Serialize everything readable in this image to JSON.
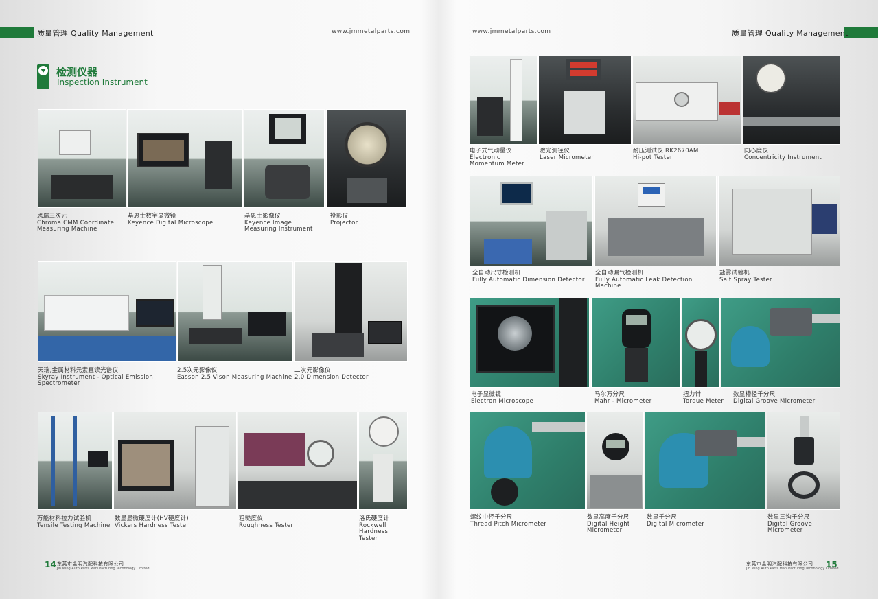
{
  "left_page": {
    "header": {
      "title": "质量管理  Quality Management",
      "url": "www.jmmetalparts.com"
    },
    "section": {
      "title_cn": "检测仪器",
      "title_en": "Inspection Instrument"
    },
    "items": [
      {
        "cn": "思瑞三次元",
        "en": "Chroma CMM Coordinate Measuring Machine"
      },
      {
        "cn": "基恩士数字显微镜",
        "en": "Keyence Digital Microscope"
      },
      {
        "cn": "基恩士影像仪",
        "en": "Keyence Image Measuring Instrument"
      },
      {
        "cn": "投影仪",
        "en": "Projector"
      },
      {
        "cn": "天瑞,金属材料元素直读光谱仪",
        "en": "Skyray Instrument - Optical Emission Spectrometer"
      },
      {
        "cn": "2.5次元影像仪",
        "en": "Easson 2.5 Vison Measuring Machine"
      },
      {
        "cn": "二次元影像仪",
        "en": "2.0 Dimension Detector"
      },
      {
        "cn": "万能材料拉力试验机",
        "en": "Tensile Testing Machine"
      },
      {
        "cn": "数显显微硬度计(HV硬度计)",
        "en": "Vickers Hardness Tester"
      },
      {
        "cn": "粗糙度仪",
        "en": "Roughness Tester"
      },
      {
        "cn": "洛氏硬度计",
        "en": "Rockwell Hardness Tester"
      }
    ],
    "footer": {
      "page_number": "14",
      "company_cn": "东莞市金明汽配科技有限公司",
      "company_en": "Jin Ming Auto Parts Manufacturing Technology Limited"
    }
  },
  "right_page": {
    "header": {
      "title": "质量管理  Quality Management",
      "url": "www.jmmetalparts.com"
    },
    "items": [
      {
        "cn": "电子式气动量仪",
        "en": "Electronic Momentum Meter"
      },
      {
        "cn": "激光测径仪",
        "en": "Laser Micrometer"
      },
      {
        "cn": "耐压测试仪 RK2670AM",
        "en": "Hi-pot  Tester"
      },
      {
        "cn": "同心度仪",
        "en": "Concentricity Instrument"
      },
      {
        "cn": "全自动尺寸检测机",
        "en": "Fully Automatic Dimension Detector"
      },
      {
        "cn": "全自动漏气检测机",
        "en": "Fully Automatic Leak Detection Machine"
      },
      {
        "cn": "盐雾试验机",
        "en": "Salt Spray Tester"
      },
      {
        "cn": "电子显微镜",
        "en": "Electron Microscope"
      },
      {
        "cn": "马尔万分尺",
        "en": "Mahr - Micrometer"
      },
      {
        "cn": "扭力计",
        "en": "Torque Meter"
      },
      {
        "cn": "数显槽径千分尺",
        "en": "Digital Groove Micrometer"
      },
      {
        "cn": "螺纹中径千分尺",
        "en": "Thread Pitch Micrometer"
      },
      {
        "cn": "数显高度千分尺",
        "en": "Digital Height Micrometer"
      },
      {
        "cn": "数显千分尺",
        "en": "Digital Micrometer"
      },
      {
        "cn": "数显三沟千分尺",
        "en": "Digital Groove Micrometer"
      }
    ],
    "footer": {
      "page_number": "15",
      "company_cn": "东莞市金明汽配科技有限公司",
      "company_en": "Jin Ming Auto Parts Manufacturing Technology Limited"
    }
  },
  "colors": {
    "accent": "#1f7a3a",
    "rule": "#6d9f79"
  }
}
